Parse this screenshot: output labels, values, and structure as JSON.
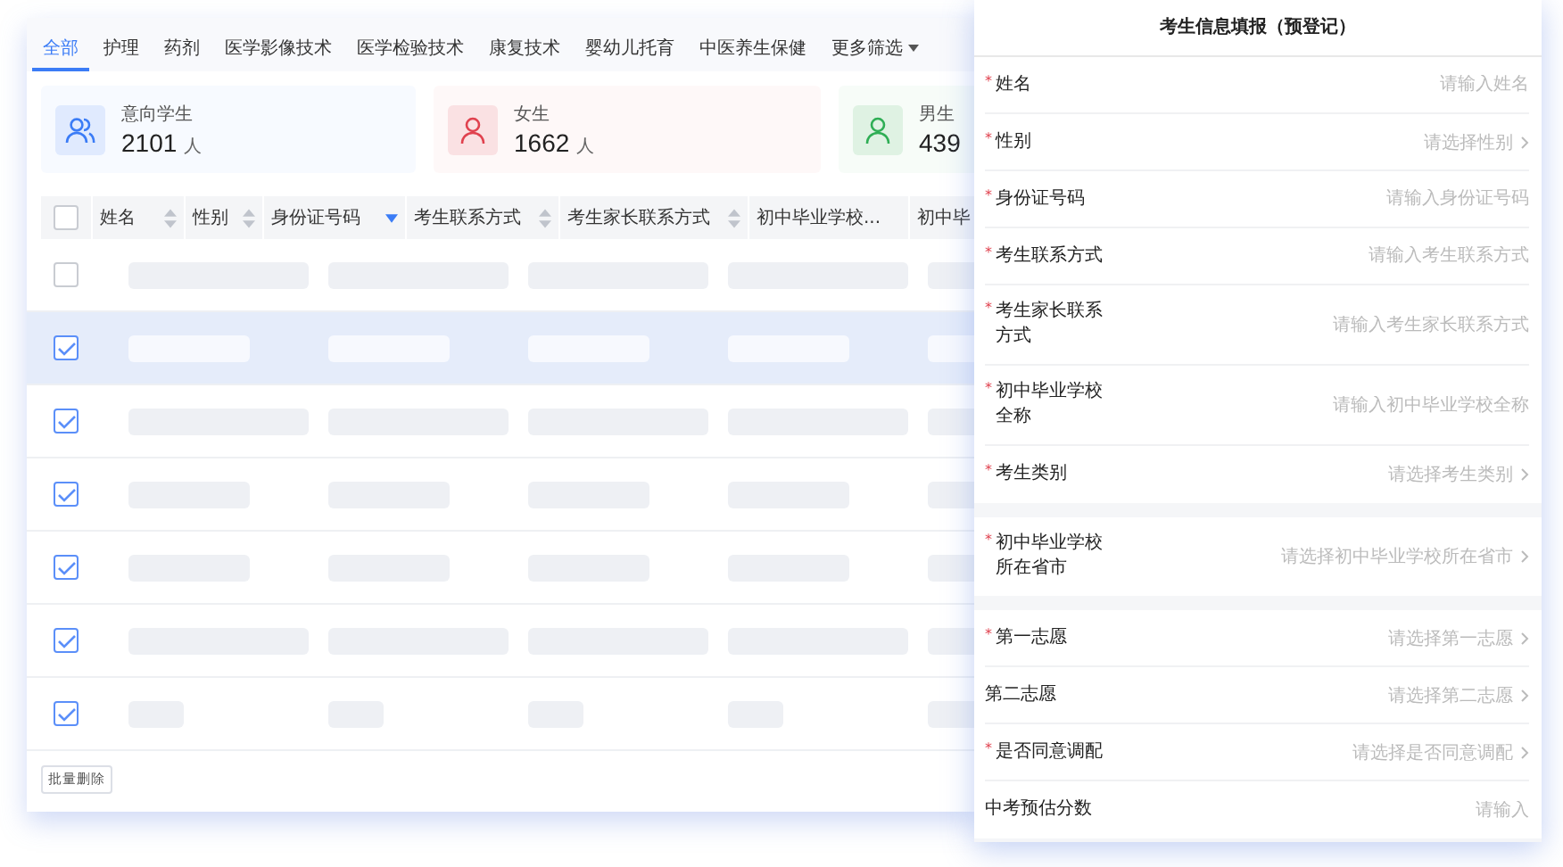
{
  "tabs": [
    {
      "label": "全部",
      "selected": true,
      "dropdown": false
    },
    {
      "label": "护理",
      "selected": false,
      "dropdown": false
    },
    {
      "label": "药剂",
      "selected": false,
      "dropdown": false
    },
    {
      "label": "医学影像技术",
      "selected": false,
      "dropdown": false
    },
    {
      "label": "医学检验技术",
      "selected": false,
      "dropdown": false
    },
    {
      "label": "康复技术",
      "selected": false,
      "dropdown": false
    },
    {
      "label": "婴幼儿托育",
      "selected": false,
      "dropdown": false
    },
    {
      "label": "中医养生保健",
      "selected": false,
      "dropdown": false
    },
    {
      "label": "更多筛选",
      "selected": false,
      "dropdown": true
    }
  ],
  "stats": [
    {
      "kind": "group",
      "label": "意向学生",
      "value": "2101",
      "unit": "人",
      "color": "#3b7cf6"
    },
    {
      "kind": "person",
      "label": "女生",
      "value": "1662",
      "unit": "人",
      "color": "#e0424f"
    },
    {
      "kind": "person",
      "label": "男生",
      "value": "439",
      "color": "#2fae55"
    }
  ],
  "table": {
    "select_all_checked": false,
    "columns": [
      {
        "label": "姓名",
        "sort_active": false
      },
      {
        "label": "性别",
        "sort_active": false
      },
      {
        "label": "身份证号码",
        "sort_active": true
      },
      {
        "label": "考生联系方式",
        "sort_active": false
      },
      {
        "label": "考生家长联系方式",
        "sort_active": false
      },
      {
        "label": "初中毕业学校..."
      },
      {
        "label": "初中毕"
      }
    ],
    "rows": [
      {
        "checked": false,
        "hovered": false,
        "kind": "long"
      },
      {
        "checked": true,
        "hovered": true,
        "kind": "short"
      },
      {
        "checked": true,
        "hovered": false,
        "kind": "long"
      },
      {
        "checked": true,
        "hovered": false,
        "kind": "short"
      },
      {
        "checked": true,
        "hovered": false,
        "kind": "short"
      },
      {
        "checked": true,
        "hovered": false,
        "kind": "long"
      },
      {
        "checked": true,
        "hovered": false,
        "kind": "tiny"
      }
    ]
  },
  "batch_delete": "批量删除",
  "form": {
    "title": "考生信息填报（预登记）",
    "required_sign": "*",
    "groups": [
      [
        {
          "label": "姓名",
          "required": true,
          "placeholder": "请输入姓名",
          "kind": "input"
        },
        {
          "label": "性别",
          "required": true,
          "placeholder": "请选择性别",
          "kind": "select"
        },
        {
          "label": "身份证号码",
          "required": true,
          "placeholder": "请输入身份证号码",
          "kind": "input"
        },
        {
          "label": "考生联系方式",
          "required": true,
          "placeholder": "请输入考生联系方式",
          "kind": "input"
        },
        {
          "label": "考生家长联系方式",
          "required": true,
          "placeholder": "请输入考生家长联系方式",
          "kind": "input"
        },
        {
          "label": "初中毕业学校全称",
          "required": true,
          "placeholder": "请输入初中毕业学校全称",
          "kind": "input"
        },
        {
          "label": "考生类别",
          "required": true,
          "placeholder": "请选择考生类别",
          "kind": "select"
        }
      ],
      [
        {
          "label": "初中毕业学校所在省市",
          "required": true,
          "placeholder": "请选择初中毕业学校所在省市",
          "kind": "select"
        }
      ],
      [
        {
          "label": "第一志愿",
          "required": true,
          "placeholder": "请选择第一志愿",
          "kind": "select"
        },
        {
          "label": "第二志愿",
          "required": false,
          "placeholder": "请选择第二志愿",
          "kind": "select"
        },
        {
          "label": "是否同意调配",
          "required": true,
          "placeholder": "请选择是否同意调配",
          "kind": "select"
        },
        {
          "label": "中考预估分数",
          "required": false,
          "placeholder": "请输入",
          "kind": "input"
        }
      ]
    ]
  }
}
